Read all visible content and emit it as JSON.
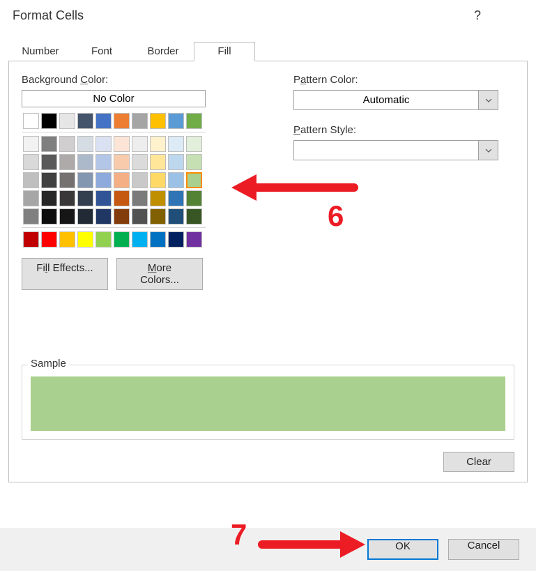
{
  "title": "Format Cells",
  "help_tooltip": "?",
  "tabs": [
    "Number",
    "Font",
    "Border",
    "Fill"
  ],
  "active_tab": 3,
  "left": {
    "bg_label_pre": "Background ",
    "bg_label_u": "C",
    "bg_label_post": "olor:",
    "no_color": "No Color",
    "fill_effects_pre": "Fi",
    "fill_effects_u": "l",
    "fill_effects_post": "l Effects...",
    "more_colors_u": "M",
    "more_colors_post": "ore Colors..."
  },
  "right": {
    "pat_color_pre": "P",
    "pat_color_u": "a",
    "pat_color_post": "ttern Color:",
    "pat_color_value": "Automatic",
    "pat_style_u": "P",
    "pat_style_post": "attern Style:",
    "pat_style_value": ""
  },
  "sample_label": "Sample",
  "sample_color": "#a9d08e",
  "clear_label": "Clear",
  "ok_label": "OK",
  "cancel_label": "Cancel",
  "annotation_6": "6",
  "annotation_7": "7",
  "theme_row1": [
    "#ffffff",
    "#000000",
    "#e7e6e6",
    "#44546a",
    "#4472c4",
    "#ed7d31",
    "#a5a5a5",
    "#ffc000",
    "#5b9bd5",
    "#70ad47"
  ],
  "theme_grid": [
    [
      "#f2f2f2",
      "#7f7f7f",
      "#d0cece",
      "#d6dce4",
      "#d9e1f2",
      "#fce4d6",
      "#ededed",
      "#fff2cc",
      "#ddebf7",
      "#e2efda"
    ],
    [
      "#d9d9d9",
      "#595959",
      "#aeaaaa",
      "#acb9ca",
      "#b4c6e7",
      "#f8cbad",
      "#dbdbdb",
      "#ffe699",
      "#bdd7ee",
      "#c6e0b4"
    ],
    [
      "#bfbfbf",
      "#404040",
      "#757171",
      "#8497b0",
      "#8ea9db",
      "#f4b084",
      "#c9c9c9",
      "#ffd966",
      "#9bc2e6",
      "#a9d08e"
    ],
    [
      "#a6a6a6",
      "#262626",
      "#3a3838",
      "#333f4f",
      "#305496",
      "#c65911",
      "#7b7b7b",
      "#bf8f00",
      "#2f75b5",
      "#548235"
    ],
    [
      "#808080",
      "#0d0d0d",
      "#161616",
      "#222b35",
      "#203764",
      "#833c0c",
      "#525252",
      "#806000",
      "#1f4e78",
      "#375623"
    ]
  ],
  "std_colors": [
    "#c00000",
    "#ff0000",
    "#ffc000",
    "#ffff00",
    "#92d050",
    "#00b050",
    "#00b0f0",
    "#0070c0",
    "#002060",
    "#7030a0"
  ],
  "selected_swatch": {
    "grid": "theme",
    "row": 2,
    "col": 9
  }
}
